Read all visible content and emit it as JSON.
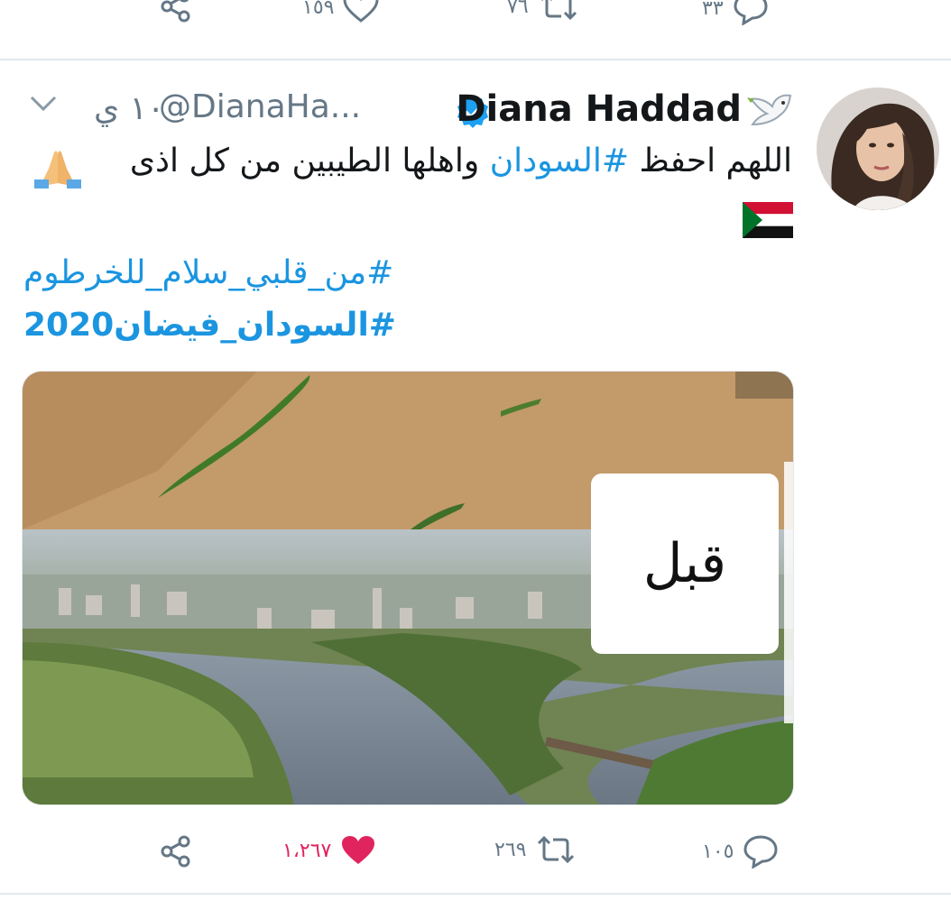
{
  "previous_tweet": {
    "actions": {
      "reply_count": "٣٣",
      "retweet_count": "٧٦",
      "like_count": "١٥٩"
    }
  },
  "tweet": {
    "author": {
      "name": "Diana Haddad",
      "handle": "@DianaHa...",
      "verified": true,
      "emoji_prefix": "dove-icon"
    },
    "time": "١٠ ي",
    "text_line1_part1": "اللهم احفظ ",
    "text_hashtag": "#السودان",
    "text_line1_part2": " واهلها الطيبين من كل اذى",
    "hashtags": [
      "#من_قلبي_سلام_للخرطوم",
      "#السودان_فيضان2020"
    ],
    "media": {
      "overlay_label": "قبل"
    },
    "actions": {
      "reply_count": "١٠٥",
      "retweet_count": "٢٦٩",
      "like_count": "١،٢٦٧",
      "liked": true
    }
  },
  "colors": {
    "accent": "#1b95e0",
    "muted": "#657786",
    "like": "#e0245e",
    "verified": "#1da1f2",
    "divider": "#e1e8ed"
  }
}
